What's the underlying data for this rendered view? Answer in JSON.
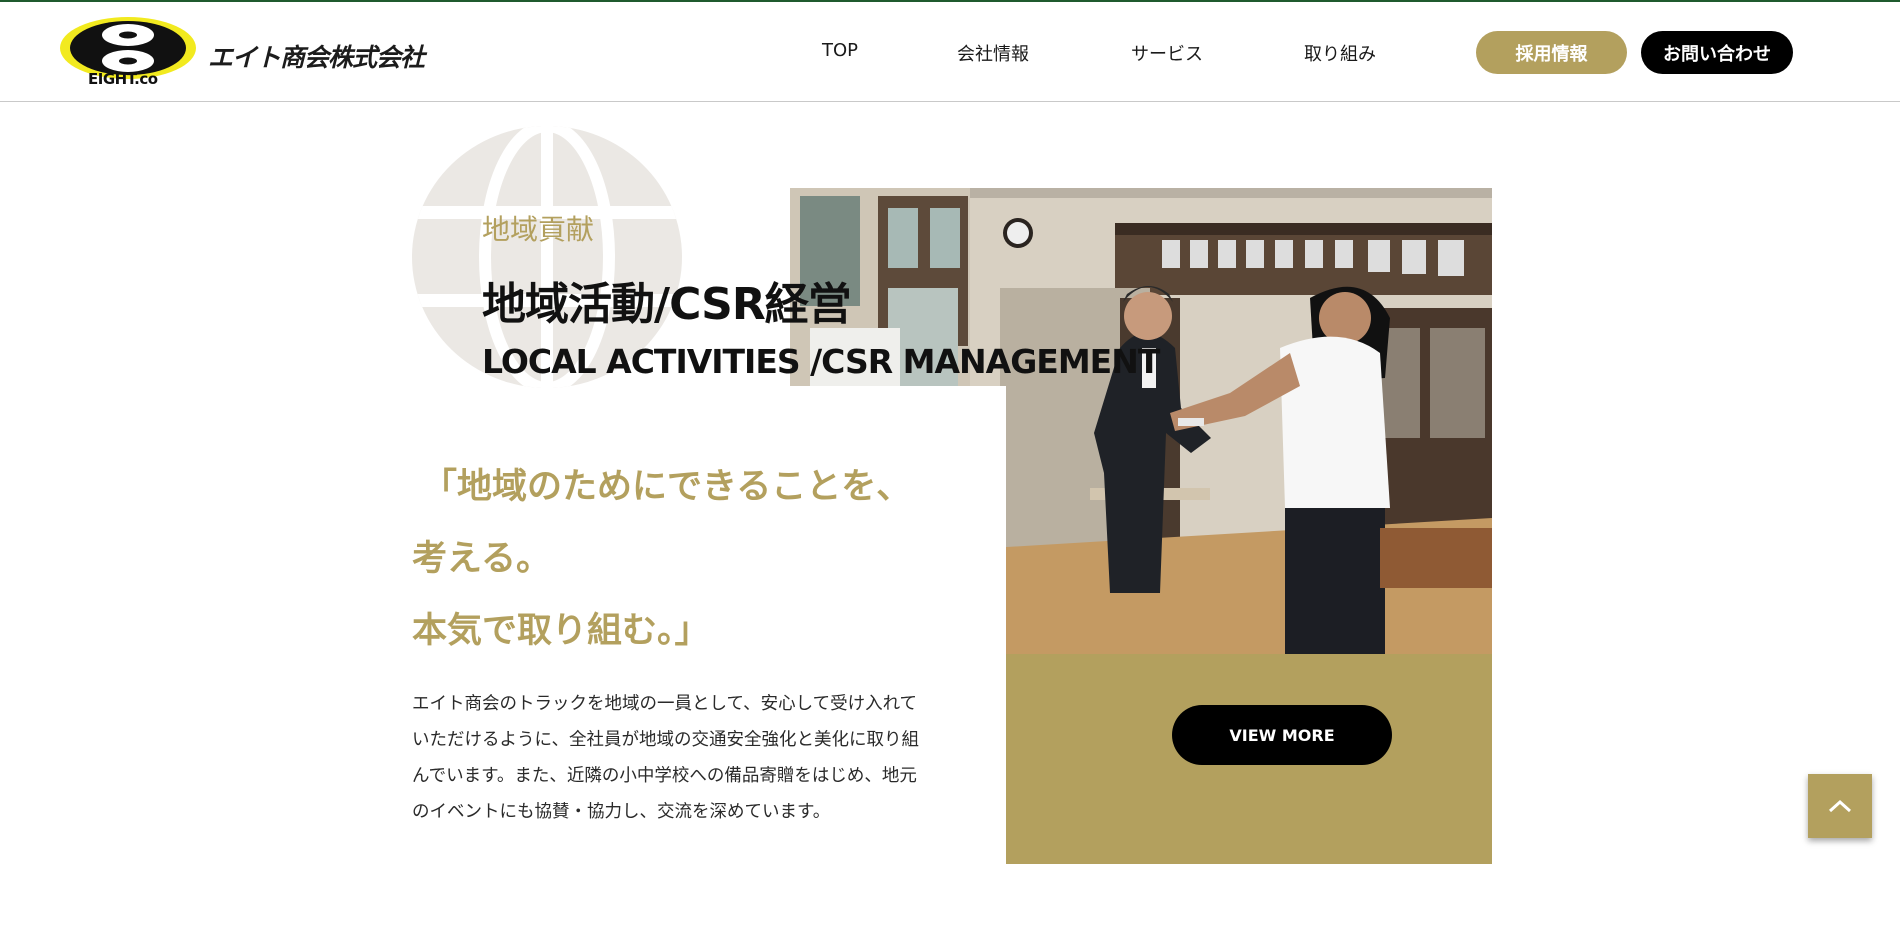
{
  "header": {
    "logo_subtext": "EIGHT.co",
    "logo_company_name": "エイト商会株式会社",
    "nav": [
      {
        "label": "TOP"
      },
      {
        "label": "会社情報"
      },
      {
        "label": "サービス"
      },
      {
        "label": "取り組み"
      }
    ],
    "recruit_label": "採用情報",
    "contact_label": "お問い合わせ"
  },
  "section": {
    "kicker": "地域貢献",
    "title_ja": "地域活動/CSR経営",
    "title_en": "LOCAL ACTIVITIES /CSR MANAGEMENT",
    "catch_lines": [
      "「地域のためにできることを、",
      "考える。",
      "本気で取り組む。」"
    ],
    "body": "エイト商会のトラックを地域の一員として、安心して受け入れていただけるように、全社員が地域の交通安全強化と美化に取り組んでいます。また、近隣の小中学校への備品寄贈をはじめ、地元のイベントにも協賛・協力し、交流を深めています。",
    "view_more_label": "VIEW MORE"
  },
  "colors": {
    "accent_gold": "#b3a05e",
    "header_topline": "#1f5a2e",
    "button_black": "#000000"
  },
  "icons": {
    "logo": "eight-logo-icon",
    "globe": "globe-icon",
    "to_top": "chevron-up-icon"
  }
}
